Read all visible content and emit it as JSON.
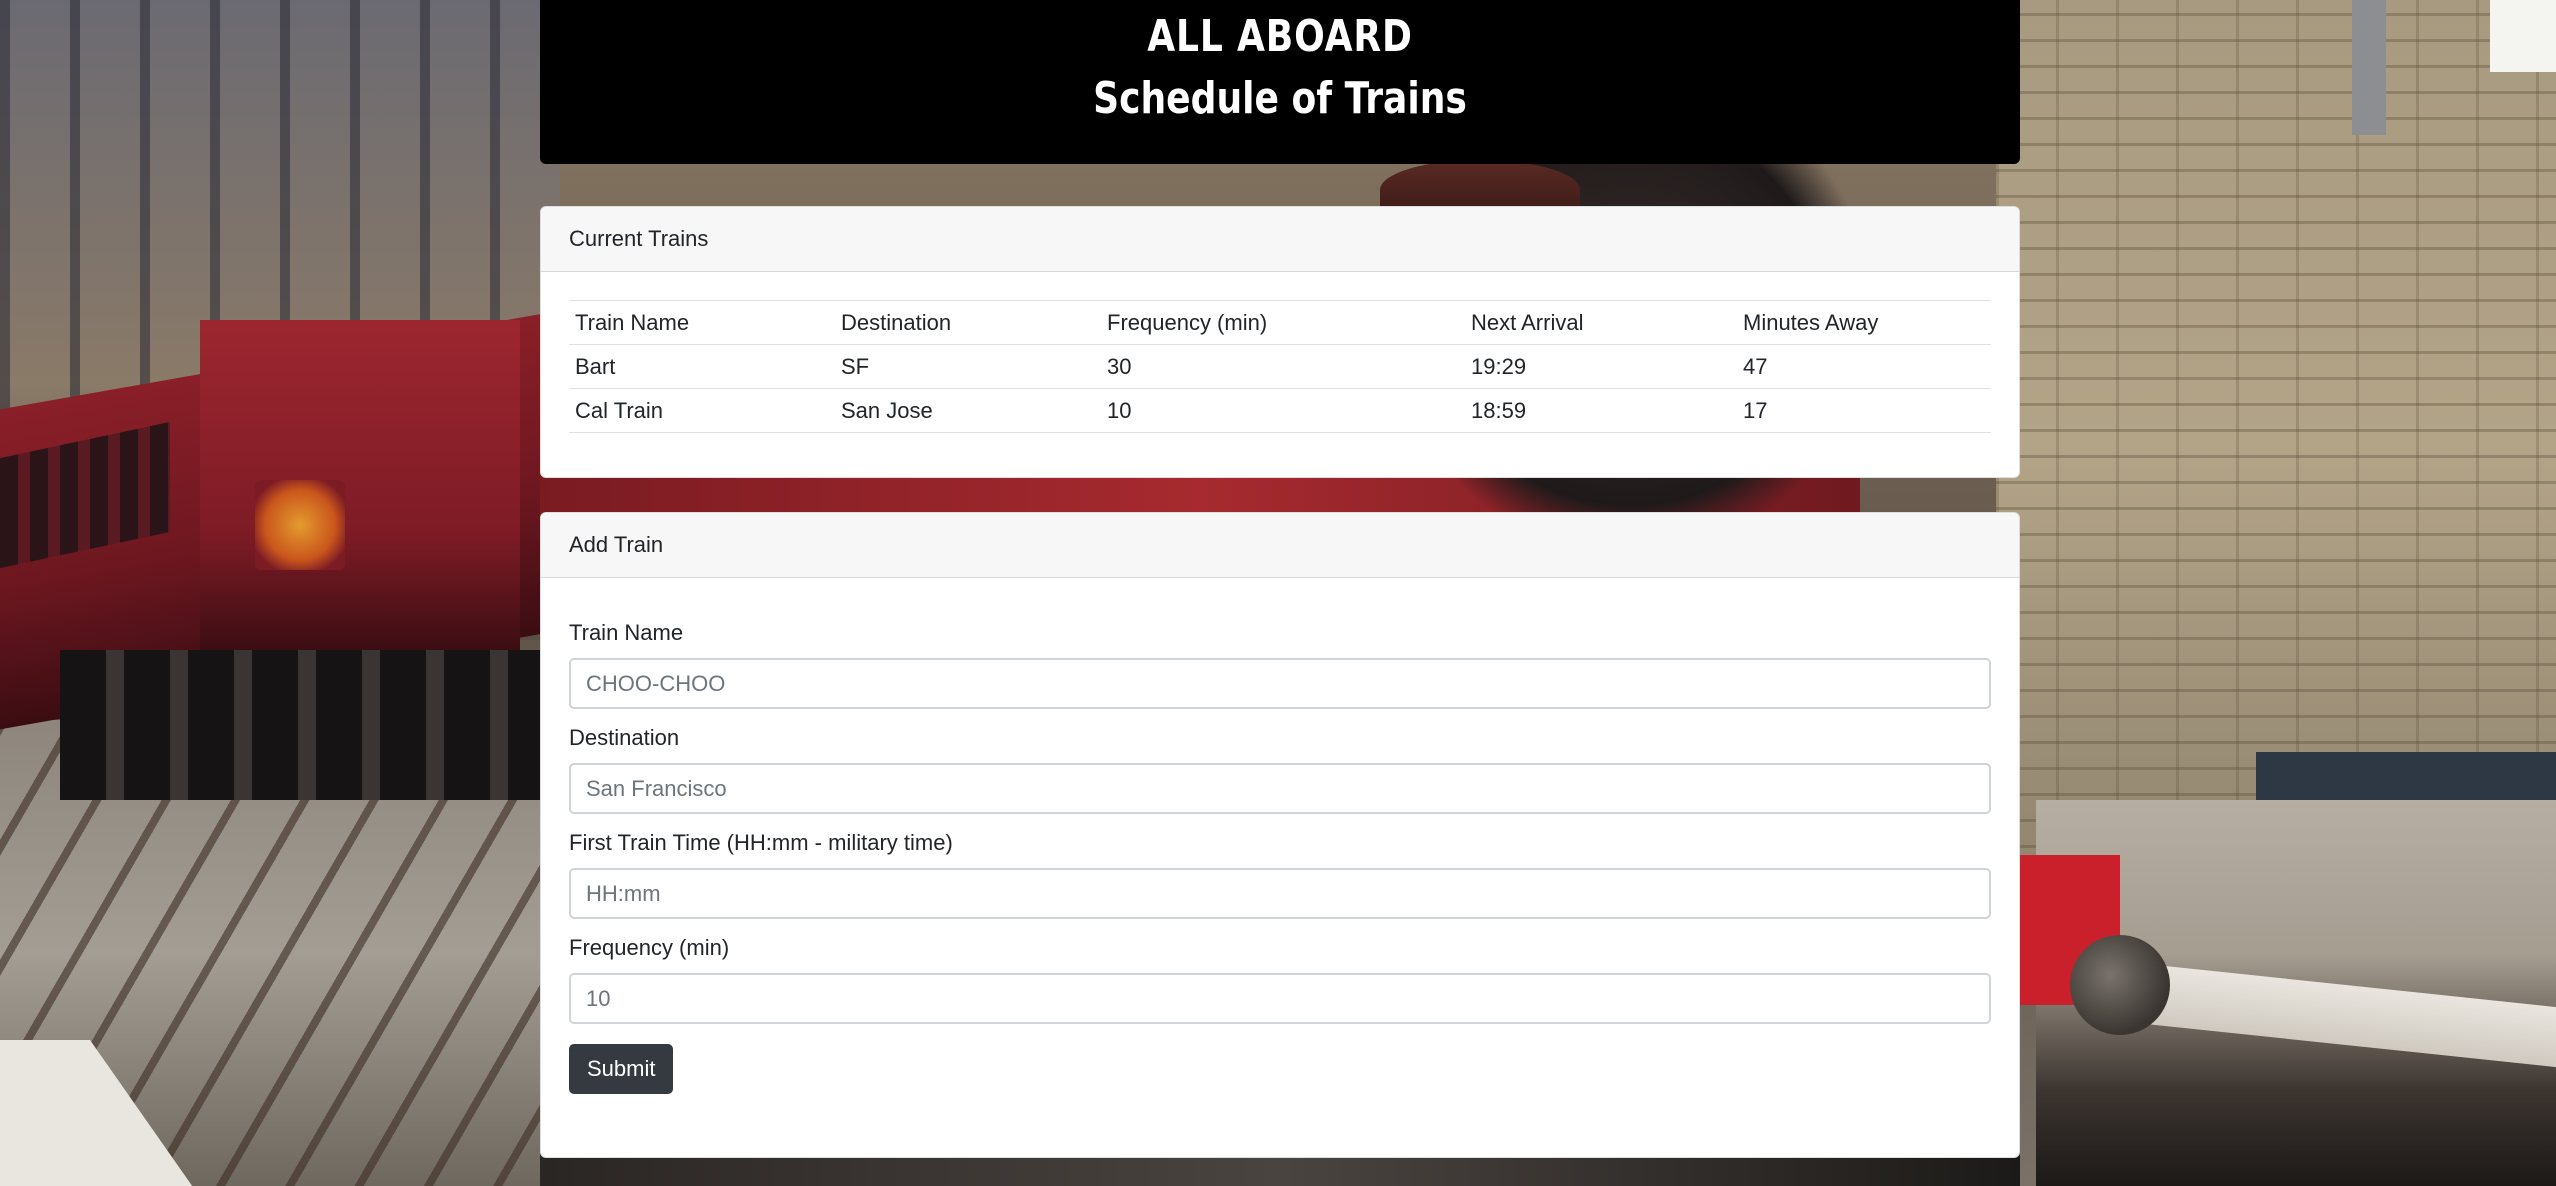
{
  "header": {
    "title": "ALL ABOARD",
    "subtitle": "Schedule of Trains"
  },
  "current_trains": {
    "heading": "Current Trains",
    "columns": [
      "Train Name",
      "Destination",
      "Frequency (min)",
      "Next Arrival",
      "Minutes Away"
    ],
    "rows": [
      [
        "Bart",
        "SF",
        "30",
        "19:29",
        "47"
      ],
      [
        "Cal Train",
        "San Jose",
        "10",
        "18:59",
        "17"
      ]
    ]
  },
  "add_train": {
    "heading": "Add Train",
    "fields": [
      {
        "label": "Train Name",
        "placeholder": "CHOO-CHOO",
        "value": ""
      },
      {
        "label": "Destination",
        "placeholder": "San Francisco",
        "value": ""
      },
      {
        "label": "First Train Time (HH:mm - military time)",
        "placeholder": "HH:mm",
        "value": ""
      },
      {
        "label": "Frequency (min)",
        "placeholder": "10",
        "value": ""
      }
    ],
    "submit_label": "Submit"
  },
  "colors": {
    "header_bg": "#000000",
    "button_bg": "#343a40",
    "card_header_bg": "#f7f7f7"
  }
}
